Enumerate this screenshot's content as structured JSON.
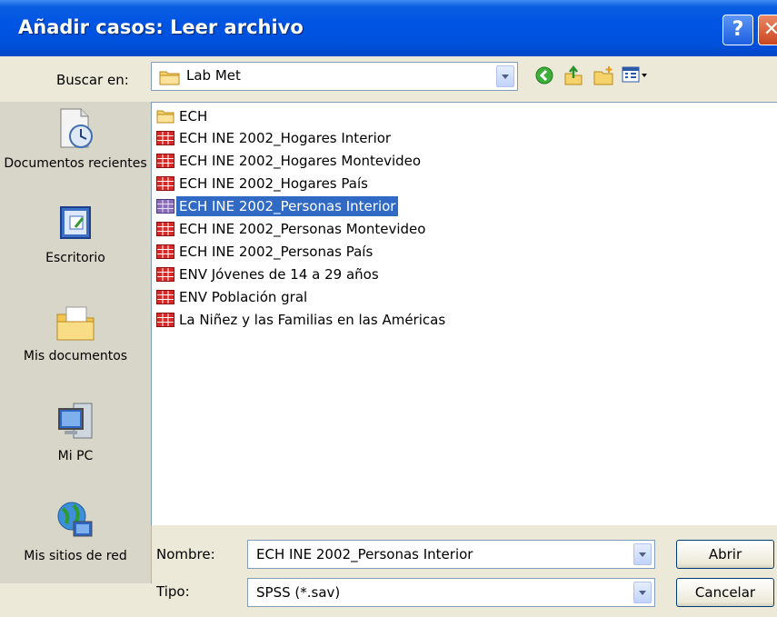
{
  "window": {
    "title": "Añadir casos: Leer archivo",
    "help_glyph": "?",
    "close_glyph": "✕"
  },
  "toolbar": {
    "look_in_label": "Buscar en:",
    "look_in_value": "Lab Met"
  },
  "places": [
    {
      "label": "Documentos recientes",
      "icon": "recent-documents-icon"
    },
    {
      "label": "Escritorio",
      "icon": "desktop-icon"
    },
    {
      "label": "Mis documentos",
      "icon": "my-documents-icon"
    },
    {
      "label": "Mi PC",
      "icon": "my-computer-icon"
    },
    {
      "label": "Mis sitios de red",
      "icon": "network-places-icon"
    }
  ],
  "files": [
    {
      "name": "ECH",
      "type": "folder"
    },
    {
      "name": "ECH INE 2002_Hogares Interior",
      "type": "spss"
    },
    {
      "name": "ECH INE 2002_Hogares Montevideo",
      "type": "spss"
    },
    {
      "name": "ECH INE 2002_Hogares País",
      "type": "spss"
    },
    {
      "name": "ECH INE 2002_Personas Interior",
      "type": "spss",
      "selected": true
    },
    {
      "name": "ECH INE 2002_Personas Montevideo",
      "type": "spss"
    },
    {
      "name": "ECH INE 2002_Personas País",
      "type": "spss"
    },
    {
      "name": "ENV Jóvenes de 14 a 29 años",
      "type": "spss"
    },
    {
      "name": "ENV Población gral",
      "type": "spss"
    },
    {
      "name": "La Niñez y las Familias en las Américas",
      "type": "spss"
    }
  ],
  "form": {
    "name_label": "Nombre:",
    "name_value": "ECH INE 2002_Personas Interior",
    "type_label": "Tipo:",
    "type_value": "SPSS (*.sav)",
    "open_label": "Abrir",
    "cancel_label": "Cancelar"
  },
  "colors": {
    "titlebar": "#0054e3",
    "selection": "#316ac5",
    "window_bg": "#ece9d8"
  }
}
